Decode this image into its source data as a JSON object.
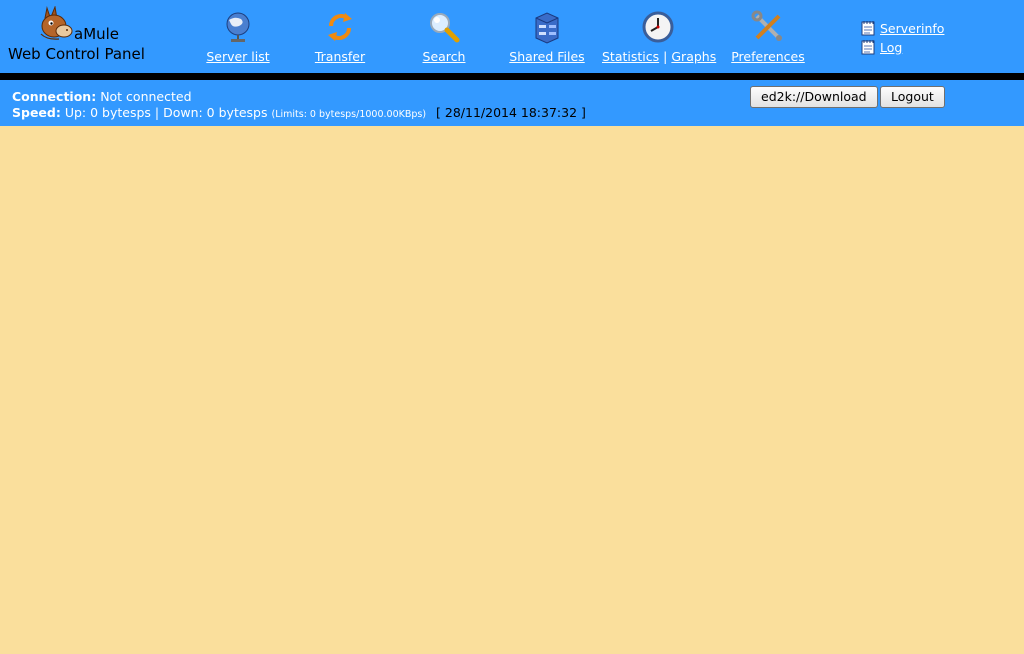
{
  "app": {
    "name": "aMule",
    "subtitle": "Web Control Panel"
  },
  "nav": [
    {
      "label": "Server list",
      "icon": "globe-icon"
    },
    {
      "label": "Transfer",
      "icon": "transfer-arrows-icon"
    },
    {
      "label": "Search",
      "icon": "magnifier-icon"
    },
    {
      "label": "Shared Files",
      "icon": "file-cabinet-icon"
    },
    {
      "label": "Statistics",
      "extra_label": "Graphs",
      "separator": "|",
      "icon": "clock-icon"
    },
    {
      "label": "Preferences",
      "icon": "tools-icon"
    }
  ],
  "side_links": [
    {
      "label": "Serverinfo",
      "icon": "notepad-icon"
    },
    {
      "label": "Log",
      "icon": "notepad-icon"
    }
  ],
  "status": {
    "connection_label": "Connection:",
    "connection_value": "Not connected",
    "speed_label": "Speed:",
    "speed_value": "Up: 0 bytesps | Down: 0 bytesps",
    "limits": "(Limits: 0 bytesps/1000.00KBps)",
    "datetime": "[ 28/11/2014 18:37:32 ]"
  },
  "buttons": {
    "download": "ed2k://Download",
    "logout": "Logout"
  },
  "colors": {
    "header_bg": "#3399FF",
    "content_bg": "#FADF9C",
    "divider": "#000000"
  }
}
